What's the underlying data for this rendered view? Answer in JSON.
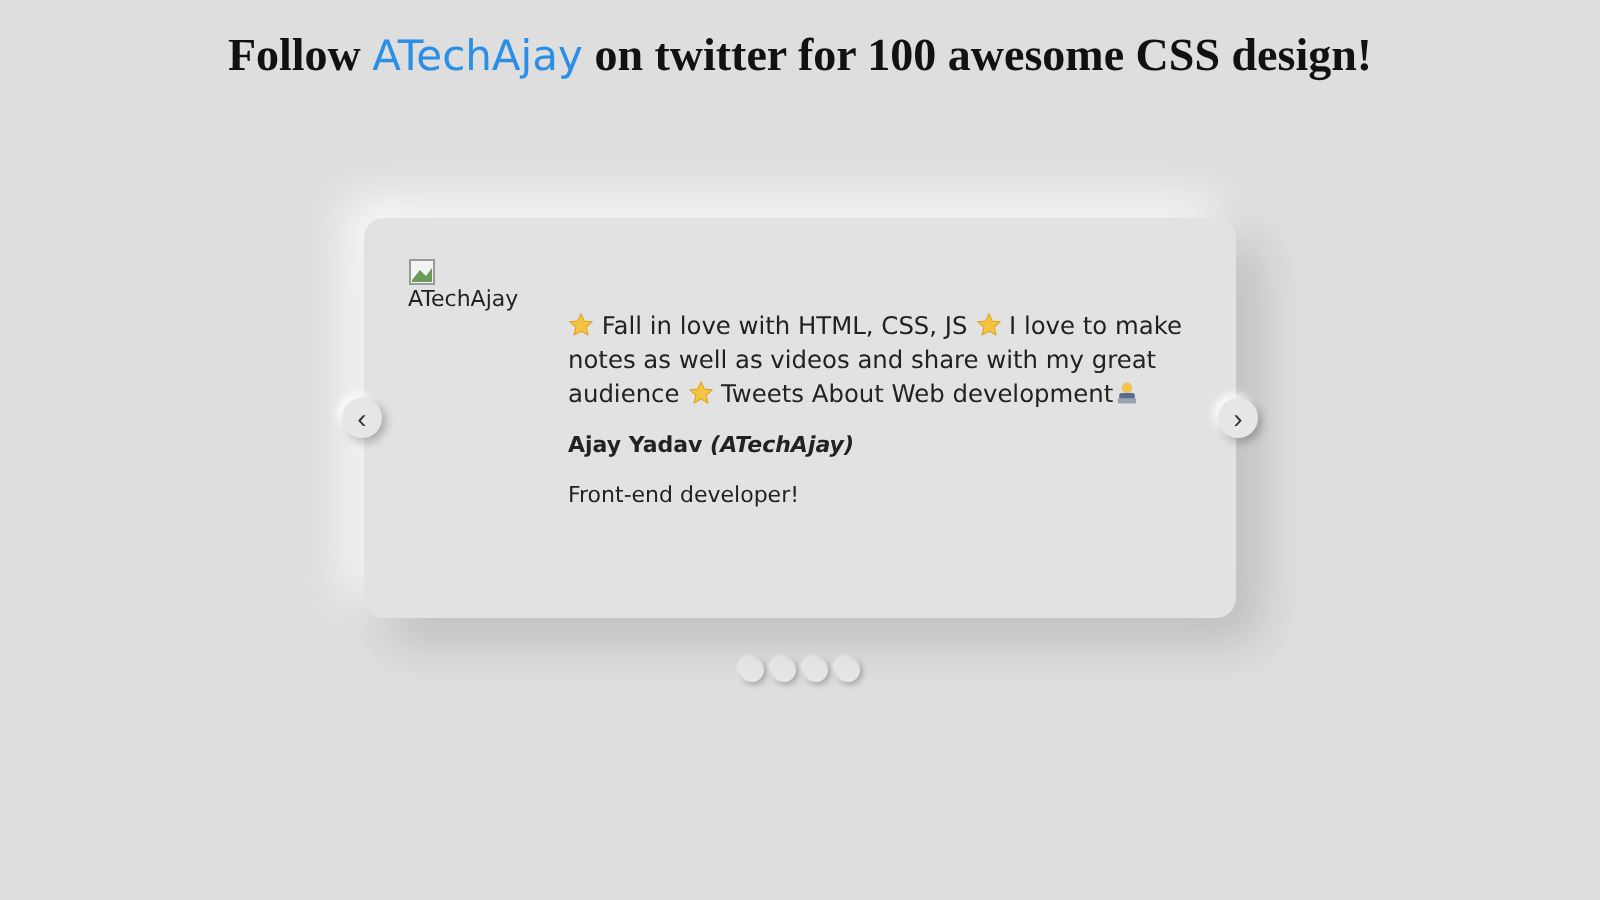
{
  "heading": {
    "before": "Follow ",
    "link": "ATechAjay",
    "after": " on twitter for 100 awesome CSS design!"
  },
  "card": {
    "image": {
      "kind": "broken-image",
      "alt": "ATechAjay"
    },
    "quote": [
      {
        "kind": "star"
      },
      {
        "kind": "text",
        "text": " Fall in love with HTML, CSS, JS "
      },
      {
        "kind": "star"
      },
      {
        "kind": "text",
        "text": " I love to make notes as well as videos and share with my great audience "
      },
      {
        "kind": "star"
      },
      {
        "kind": "text",
        "text": " Tweets About Web development"
      },
      {
        "kind": "technologist"
      }
    ],
    "name": "Ajay Yadav",
    "handle": "(ATechAjay)",
    "role": "Front-end developer!"
  },
  "prev_button": "‹",
  "next_button": "›",
  "dots": [
    {
      "selected": false
    },
    {
      "selected": false
    },
    {
      "selected": false
    },
    {
      "selected": false
    }
  ]
}
